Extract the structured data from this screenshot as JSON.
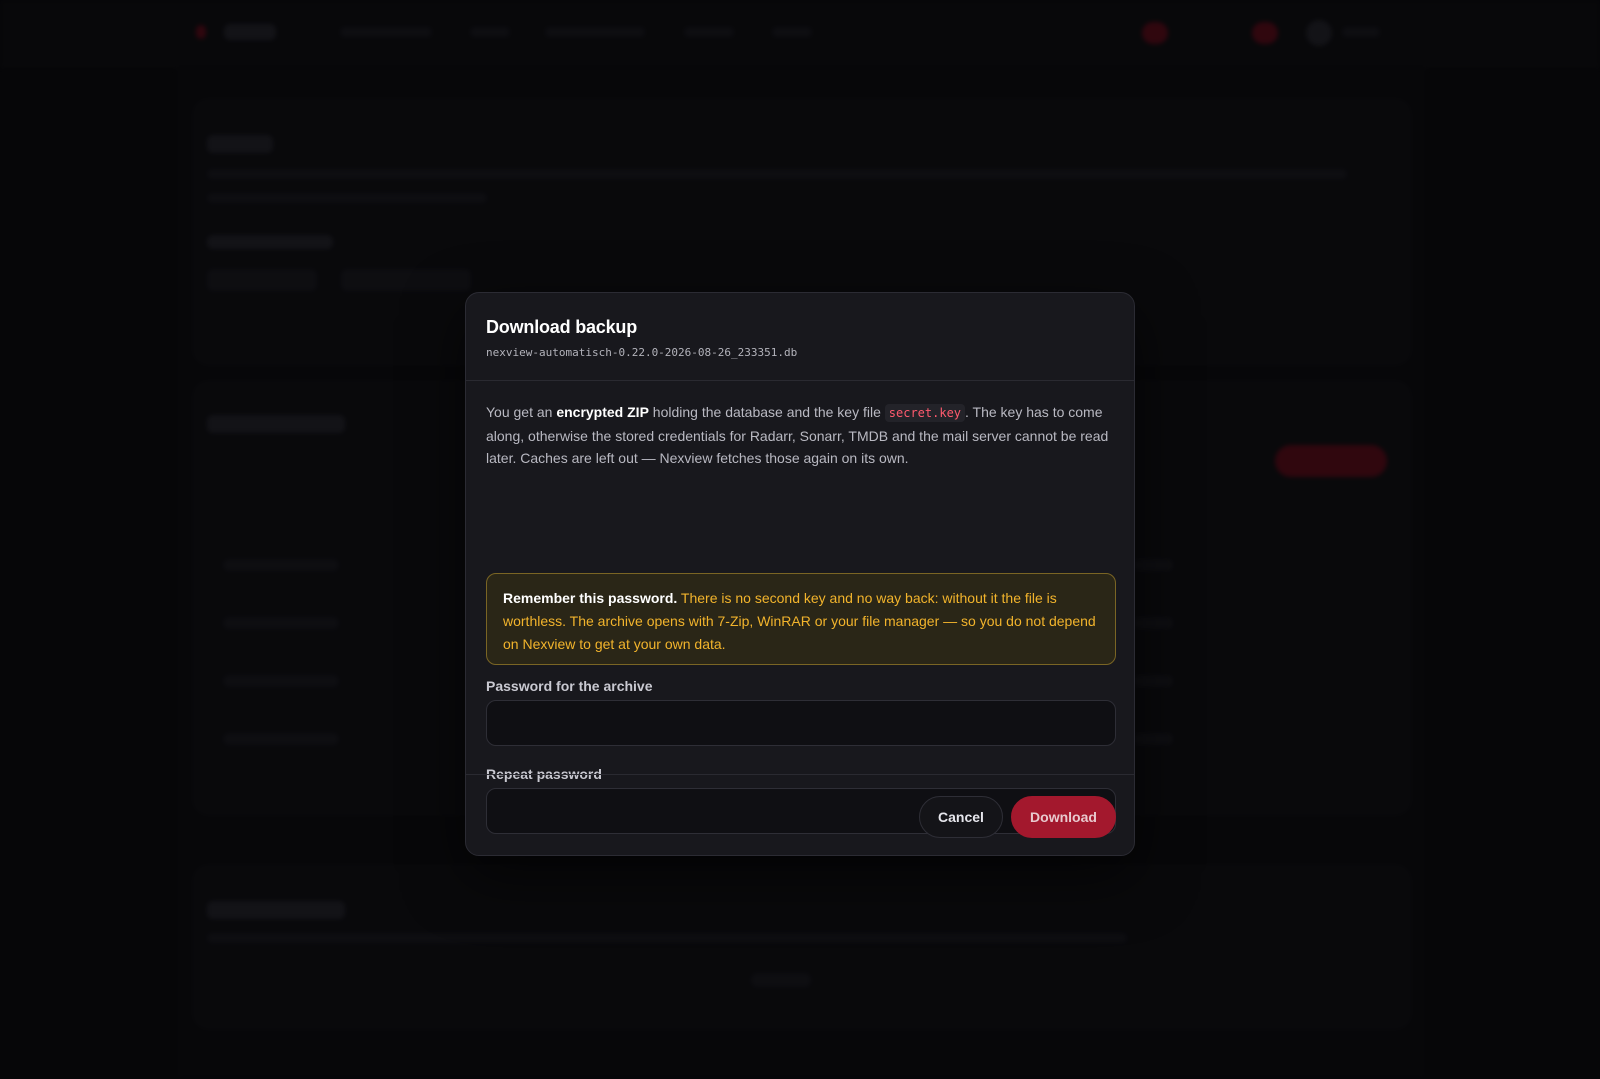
{
  "modal": {
    "title": "Download backup",
    "filename": "nexview-automatisch-0.22.0-2026-08-26_233351.db",
    "intro": {
      "part1": "You get an ",
      "bold": "encrypted ZIP",
      "part2": " holding the database and the key file ",
      "code": "secret.key",
      "part3": ". The key has to come along, otherwise the stored credentials for Radarr, Sonarr, TMDB and the mail server cannot be read later. Caches are left out — Nexview fetches those again on its own."
    },
    "warning": {
      "bold": "Remember this password.",
      "text": " There is no second key and no way back: without it the file is worthless. The archive opens with 7-Zip, WinRAR or your file manager — so you do not depend on Nexview to get at your own data."
    },
    "password_label": "Password for the archive",
    "password_value": "",
    "repeat_label": "Repeat password",
    "repeat_value": "",
    "cancel_label": "Cancel",
    "download_label": "Download"
  },
  "colors": {
    "accent": "#a3182d",
    "warning_text": "#f2b42c",
    "warning_border": "#7a6524",
    "code_text": "#ff5a6e"
  }
}
